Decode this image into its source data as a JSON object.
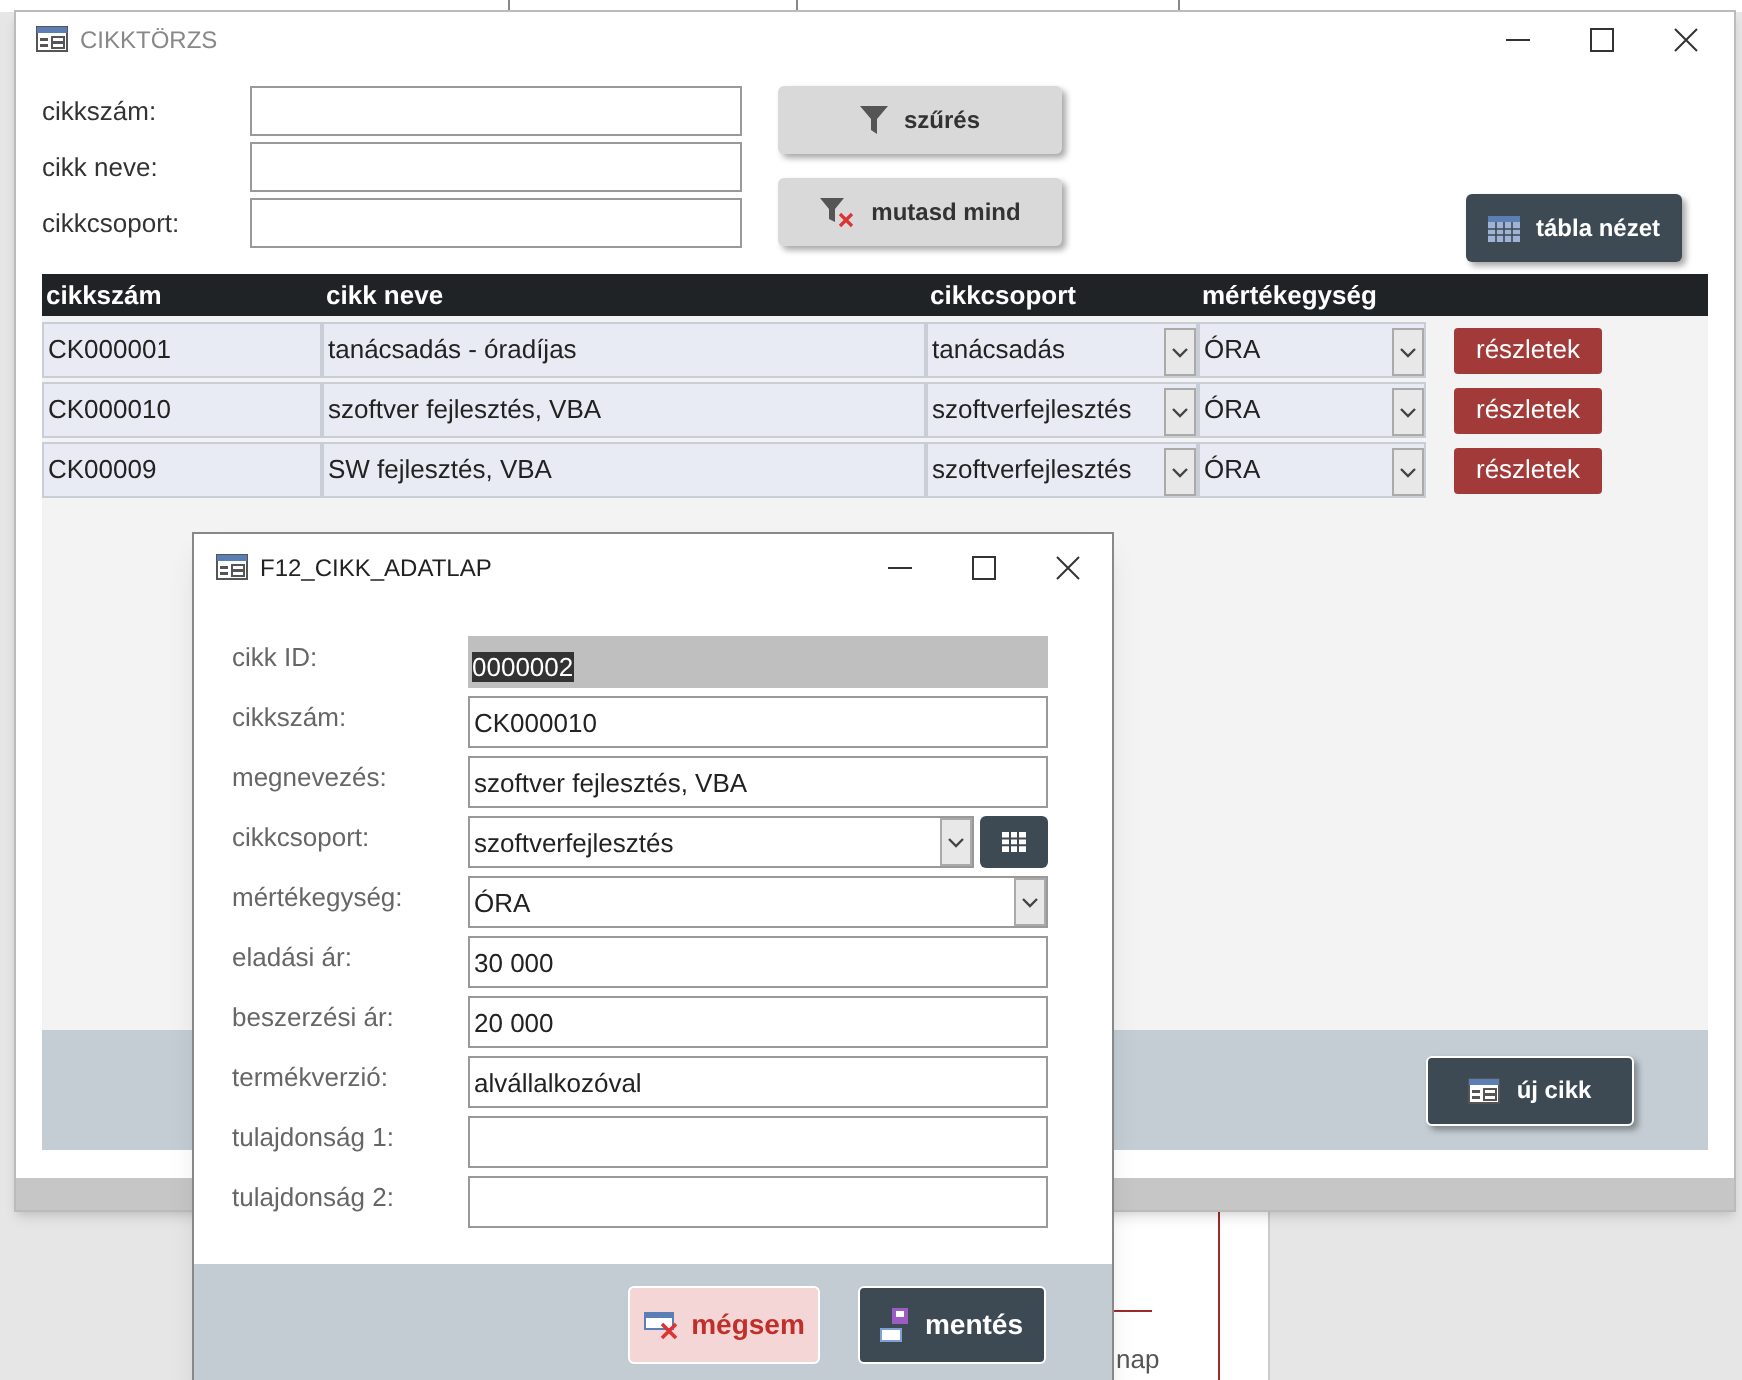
{
  "background_window": {
    "text": "nap"
  },
  "main_window": {
    "title": "CIKKTÖRZS",
    "filters": [
      {
        "label": "cikkszám:"
      },
      {
        "label": "cikk neve:"
      },
      {
        "label": "cikkcsoport:"
      }
    ],
    "buttons": [
      {
        "label": "szűrés",
        "kind": "filter"
      },
      {
        "label": "mutasd mind",
        "kind": "clear"
      }
    ],
    "view_button": "tábla nézet",
    "table": {
      "columns": [
        "cikkszám",
        "cikk neve",
        "cikkcsoport",
        "mértékegység"
      ],
      "rows": [
        {
          "cells": [
            "CK000001",
            "tanácsadás - óradíjas",
            "tanácsadás",
            "ÓRA"
          ],
          "button": "részletek"
        },
        {
          "cells": [
            "CK000010",
            "szoftver fejlesztés, VBA",
            "szoftverfejlesztés",
            "ÓRA"
          ],
          "button": "részletek"
        },
        {
          "cells": [
            "CK00009",
            "SW fejlesztés, VBA",
            "szoftverfejlesztés",
            "ÓRA"
          ],
          "button": "részletek"
        }
      ]
    },
    "new_button": "új cikk"
  },
  "dialog": {
    "title": "F12_CIKK_ADATLAP",
    "fields": [
      {
        "label": "cikk ID:",
        "value": "0000002",
        "kind": "readonly"
      },
      {
        "label": "cikkszám:",
        "value": "CK000010",
        "kind": "text"
      },
      {
        "label": "megnevezés:",
        "value": "szoftver fejlesztés, VBA",
        "kind": "text"
      },
      {
        "label": "cikkcsoport:",
        "value": "szoftverfejlesztés",
        "kind": "combo_button"
      },
      {
        "label": "mértékegység:",
        "value": "ÓRA",
        "kind": "combo"
      },
      {
        "label": "eladási ár:",
        "value": "30 000",
        "kind": "text"
      },
      {
        "label": "beszerzési ár:",
        "value": "20 000",
        "kind": "text"
      },
      {
        "label": "termékverzió:",
        "value": "alvállalkozóval",
        "kind": "text"
      },
      {
        "label": "tulajdonság 1:",
        "kind": "text"
      },
      {
        "label": "tulajdonság 2:",
        "kind": "text"
      }
    ],
    "buttons": [
      {
        "label": "mégsem",
        "kind": "cancel"
      },
      {
        "label": "mentés",
        "kind": "save"
      }
    ]
  }
}
